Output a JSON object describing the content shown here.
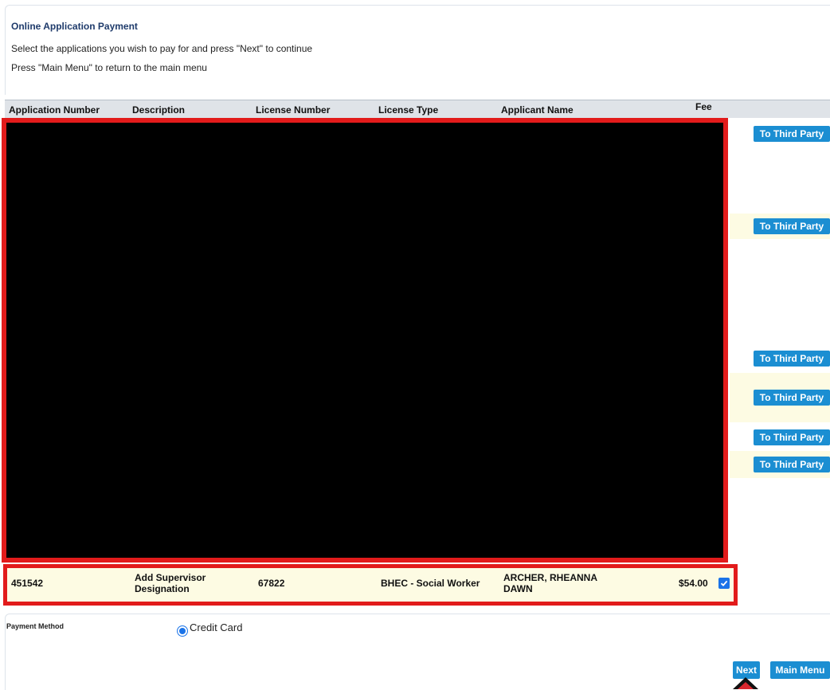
{
  "header": {
    "title": "Online Application Payment",
    "instruction_1": "Select the applications you wish to pay for and press \"Next\" to continue",
    "instruction_2": "Press \"Main Menu\" to return to the main menu"
  },
  "table": {
    "columns": [
      "Application Number",
      "Description",
      "License Number",
      "License Type",
      "Applicant Name",
      "Fee"
    ],
    "third_party_label": "To Third Party",
    "visible_row": {
      "application_number": "451542",
      "description_line1": "Add Supervisor",
      "description_line2": "Designation",
      "license_number": "67822",
      "license_type": "BHEC - Social Worker",
      "applicant_line1": "ARCHER, RHEANNA",
      "applicant_line2": "DAWN",
      "fee": "$54.00",
      "selected": true
    }
  },
  "payment": {
    "label": "Payment Method",
    "option": "Credit Card",
    "selected": true
  },
  "buttons": {
    "next": "Next",
    "main_menu": "Main Menu"
  },
  "colors": {
    "accent": "#1b8ed2",
    "title": "#1f3b6b",
    "highlight_border": "#e21b1b",
    "row_stripe": "#fdfbe3"
  }
}
